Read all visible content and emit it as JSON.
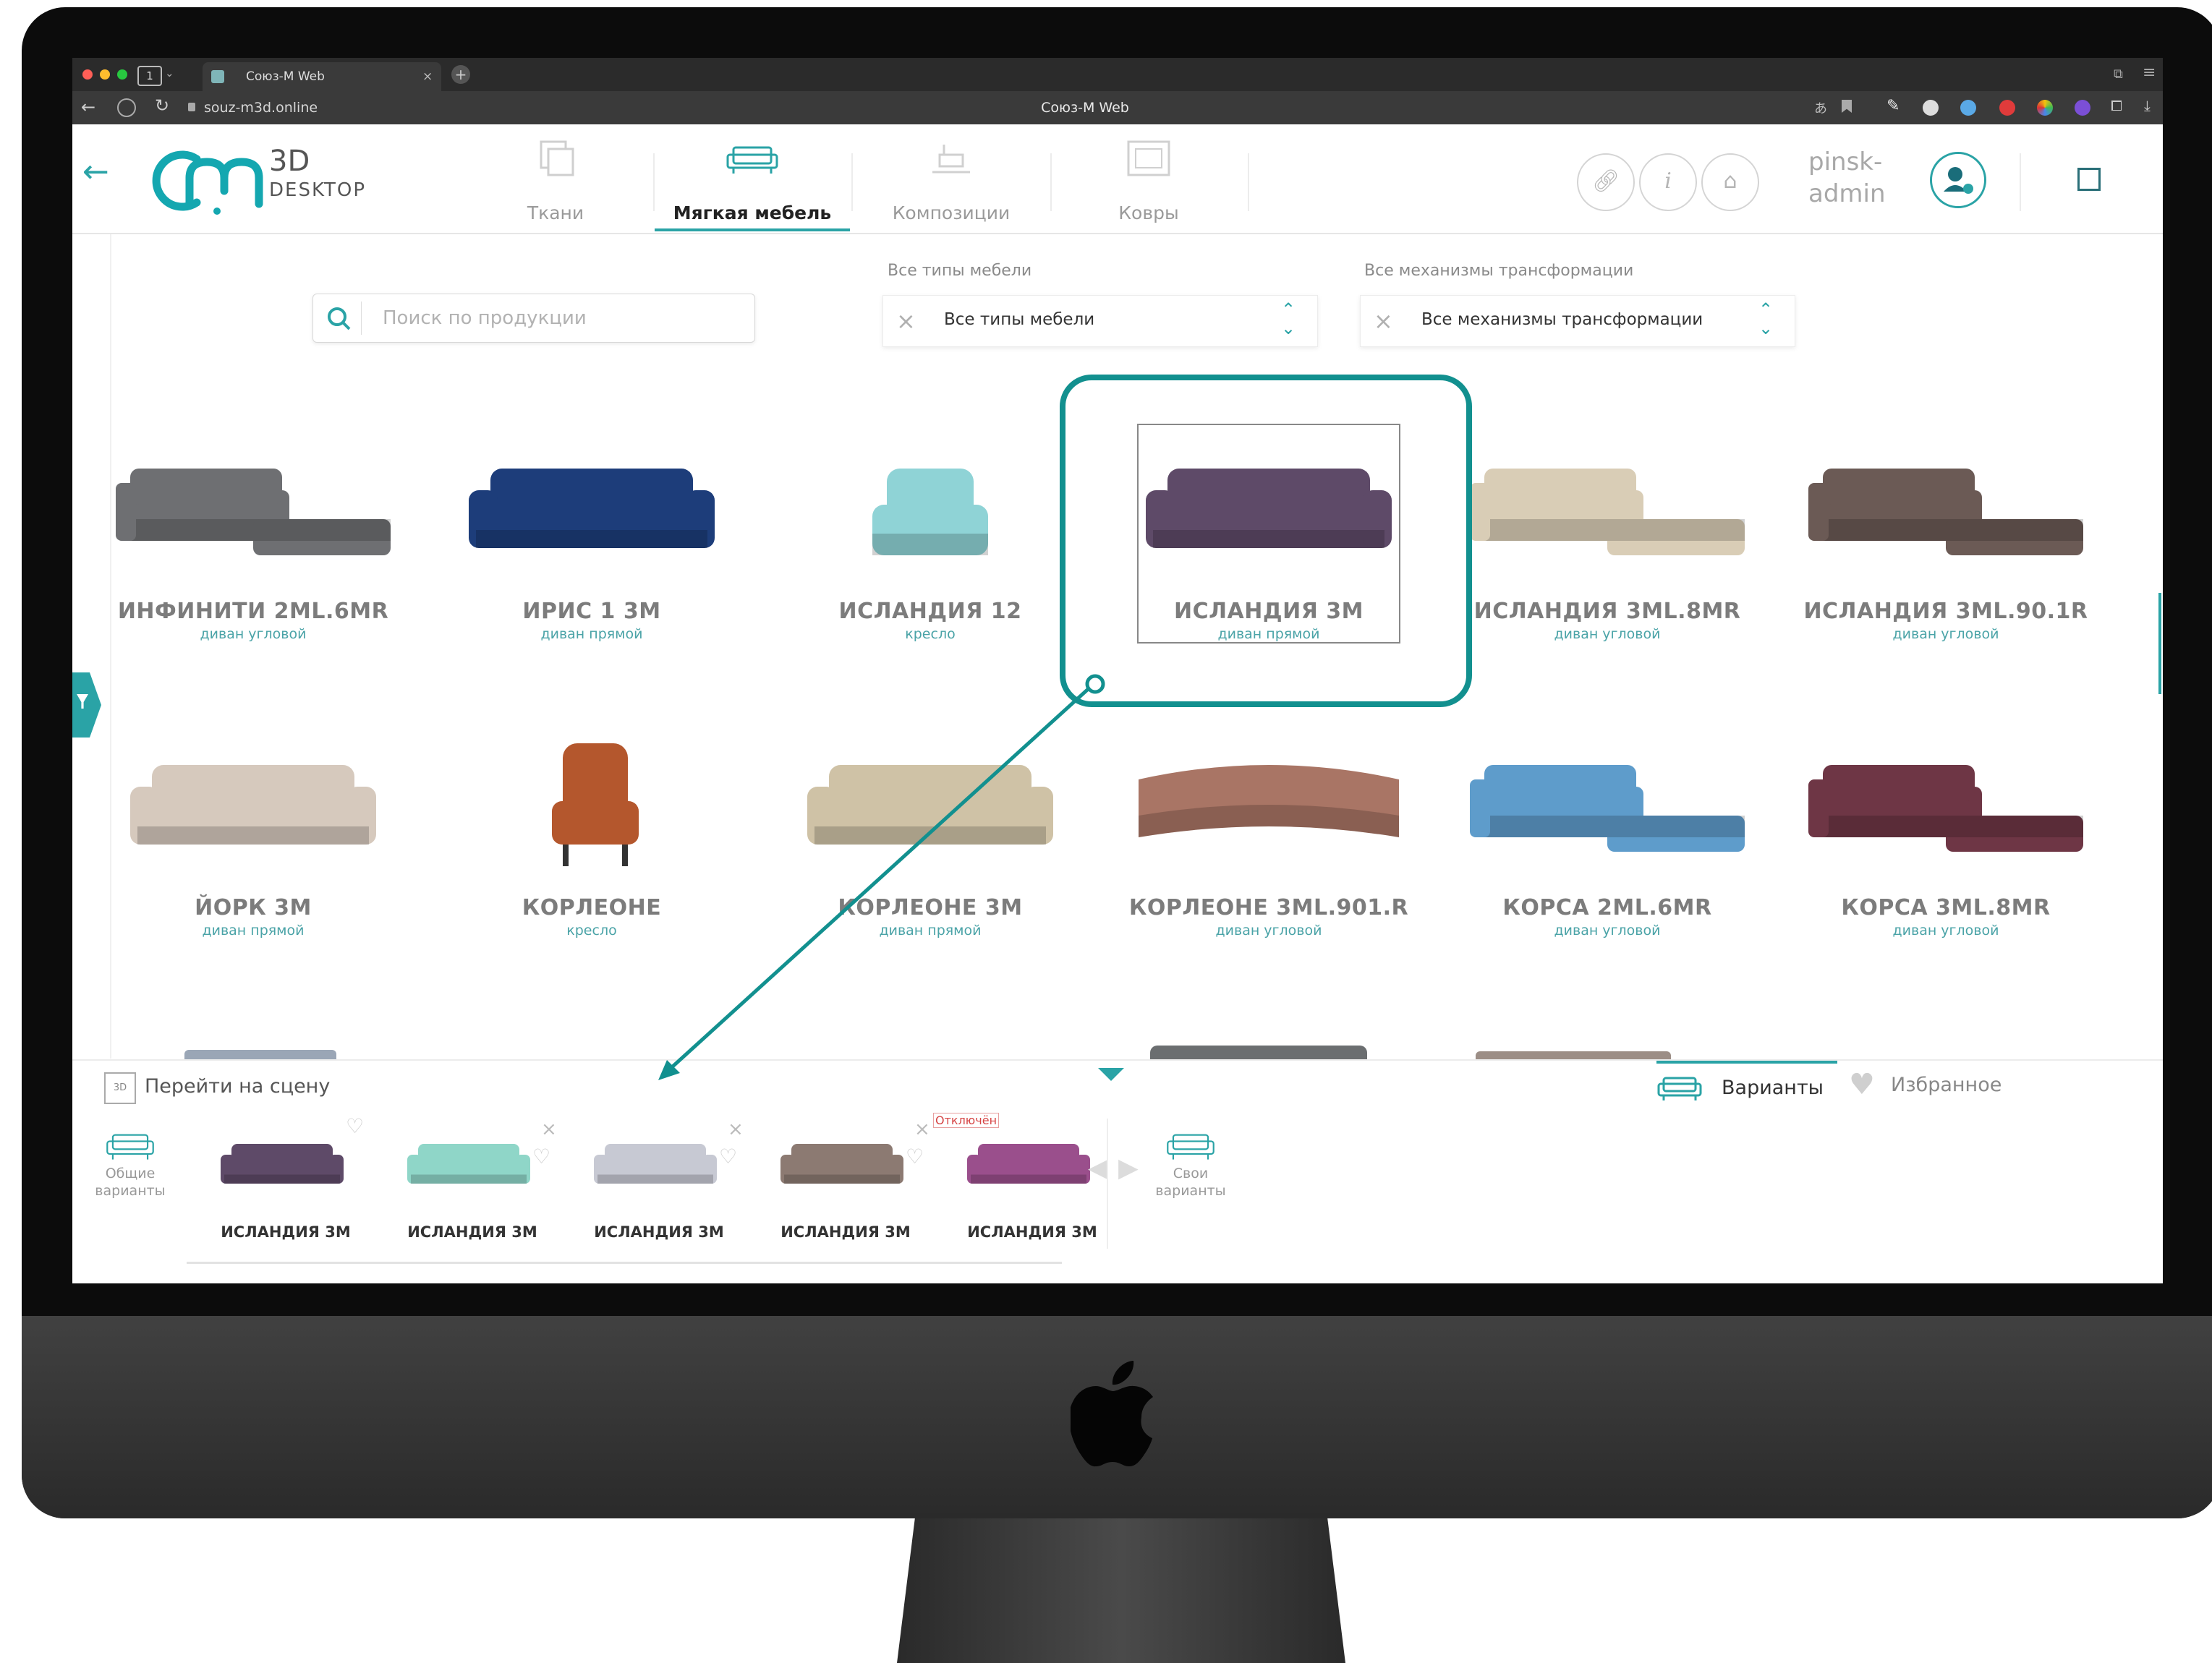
{
  "browser": {
    "tab_title": "Союз-М Web",
    "tab_count": "1",
    "url": "souz-m3d.online",
    "window_title": "Союз-М Web"
  },
  "app": {
    "logo_3d": "3D",
    "logo_desktop": "DESKTOP",
    "nav": [
      {
        "label": "Ткани"
      },
      {
        "label": "Мягкая мебель"
      },
      {
        "label": "Композиции"
      },
      {
        "label": "Ковры"
      }
    ],
    "user": {
      "line1": "pinsk-",
      "line2": "admin"
    },
    "accent": "#0f9194"
  },
  "filters": {
    "search_placeholder": "Поиск по продукции",
    "type_label": "Все типы мебели",
    "type_value": "Все типы мебели",
    "mech_label": "Все механизмы трансформации",
    "mech_value": "Все механизмы трансформации"
  },
  "products": [
    {
      "name": "ИНФИНИТИ 2ML.6MR",
      "sub": "диван угловой",
      "color": "#6e6f72",
      "shape": "corner"
    },
    {
      "name": "ИРИС 1 3М",
      "sub": "диван прямой",
      "color": "#1d3d7a",
      "shape": "sofa"
    },
    {
      "name": "ИСЛАНДИЯ 12",
      "sub": "кресло",
      "color": "#8fd3d6",
      "shape": "armchair"
    },
    {
      "name": "ИСЛАНДИЯ 3М",
      "sub": "диван прямой",
      "color": "#5e4a68",
      "shape": "sofa",
      "selected": true
    },
    {
      "name": "ИСЛАНДИЯ 3ML.8MR",
      "sub": "диван угловой",
      "color": "#d9cdb6",
      "shape": "corner"
    },
    {
      "name": "ИСЛАНДИЯ 3ML.90.1R",
      "sub": "диван угловой",
      "color": "#6b5a55",
      "shape": "corner"
    },
    {
      "name": "ЙОРК 3М",
      "sub": "диван прямой",
      "color": "#d6c9bd",
      "shape": "sofa"
    },
    {
      "name": "КОРЛЕОНЕ",
      "sub": "кресло",
      "color": "#b4572d",
      "shape": "wingchair"
    },
    {
      "name": "КОРЛЕОНЕ 3М",
      "sub": "диван прямой",
      "color": "#cfc2a6",
      "shape": "sofa"
    },
    {
      "name": "КОРЛЕОНЕ 3ML.901.R",
      "sub": "диван угловой",
      "color": "#a97565",
      "shape": "curved"
    },
    {
      "name": "КОРСА 2ML.6MR",
      "sub": "диван угловой",
      "color": "#5e9ccb",
      "shape": "corner"
    },
    {
      "name": "КОРСА 3ML.8MR",
      "sub": "диван угловой",
      "color": "#6e3645",
      "shape": "corner"
    }
  ],
  "bottom": {
    "goto_scene": "Перейти на сцену",
    "variants_tab": "Варианты",
    "favorites_tab": "Избранное",
    "common_variants": "Общие варианты",
    "own_variants": "Свои варианты",
    "disabled_badge": "Отключён",
    "variants": [
      {
        "name": "ИСЛАНДИЯ 3М",
        "color": "#5e4a68"
      },
      {
        "name": "ИСЛАНДИЯ 3М",
        "color": "#8fd6c8"
      },
      {
        "name": "ИСЛАНДИЯ 3М",
        "color": "#c7c9d3"
      },
      {
        "name": "ИСЛАНДИЯ 3М",
        "color": "#8c7a72"
      },
      {
        "name": "ИСЛАНДИЯ 3М",
        "color": "#9a4f8c"
      }
    ]
  }
}
